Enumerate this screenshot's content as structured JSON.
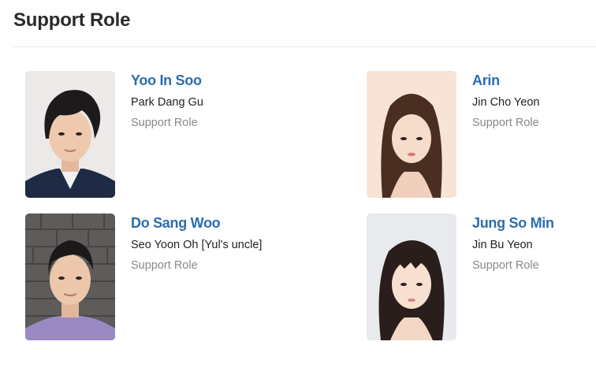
{
  "section": {
    "title": "Support Role"
  },
  "cast": [
    {
      "actor": "Yoo In Soo",
      "character": "Park Dang Gu",
      "role": "Support Role",
      "photo": "male-portrait-dark-hair-navy-jacket"
    },
    {
      "actor": "Arin",
      "character": "Jin Cho Yeon",
      "role": "Support Role",
      "photo": "female-portrait-long-brown-hair"
    },
    {
      "actor": "Do Sang Woo",
      "character": "Seo Yoon Oh [Yul's uncle]",
      "role": "Support Role",
      "photo": "male-portrait-brick-wall-lavender-sweater"
    },
    {
      "actor": "Jung So Min",
      "character": "Jin Bu Yeon",
      "role": "Support Role",
      "photo": "female-portrait-bangs-dark-hair"
    }
  ],
  "colors": {
    "link": "#2a6db0",
    "muted": "#888888",
    "divider": "#e8e8e8"
  }
}
